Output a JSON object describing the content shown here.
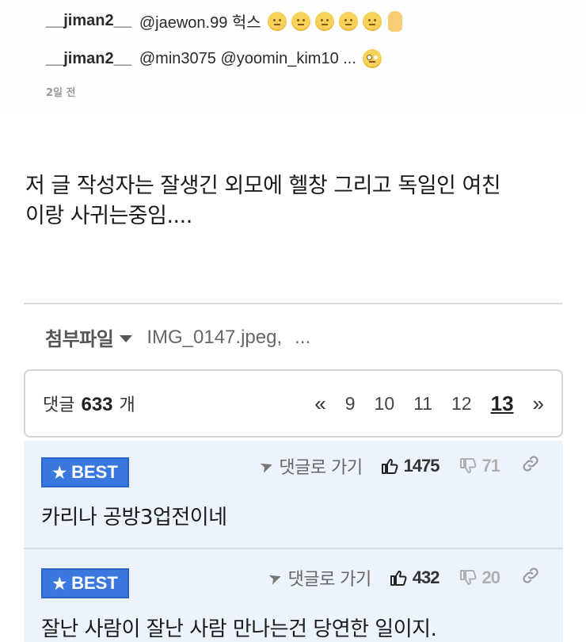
{
  "embed": {
    "comments": [
      {
        "user": "__jiman2__",
        "text": "@jaewon.99 헉스"
      },
      {
        "user": "__jiman2__",
        "text": "@min3075 @yoomin_kim10 ..."
      }
    ],
    "time": "2일 전"
  },
  "post": {
    "body_line1": "저 글 작성자는 잘생긴 외모에 헬창 그리고 독일인 여친",
    "body_line2": "이랑 사귀는중임...."
  },
  "attachments": {
    "label": "첨부파일",
    "file": "IMG_0147.jpeg,",
    "more": "..."
  },
  "comments_header": {
    "prefix": "댓글",
    "count": "633",
    "suffix": "개",
    "pages": [
      "9",
      "10",
      "11",
      "12"
    ],
    "current_page": "13",
    "prev": "«",
    "next": "»"
  },
  "best_comments": [
    {
      "badge": "BEST",
      "goto": "댓글로 가기",
      "up": "1475",
      "down": "71",
      "text": "카리나 공방3업전이네"
    },
    {
      "badge": "BEST",
      "goto": "댓글로 가기",
      "up": "432",
      "down": "20",
      "text": "잘난 사람이 잘난 사람 만나는건 당연한 일이지."
    }
  ],
  "icons": {
    "emoji": "grimace-face-icon",
    "hand": "raised-hand-icon",
    "star": "star-icon",
    "thumbs_up": "thumbs-up-icon",
    "thumbs_down": "thumbs-down-icon",
    "link": "link-icon",
    "navigate": "navigate-arrow-icon"
  },
  "colors": {
    "best_badge": "#3a78e0",
    "best_bg": "#edf3fd"
  }
}
